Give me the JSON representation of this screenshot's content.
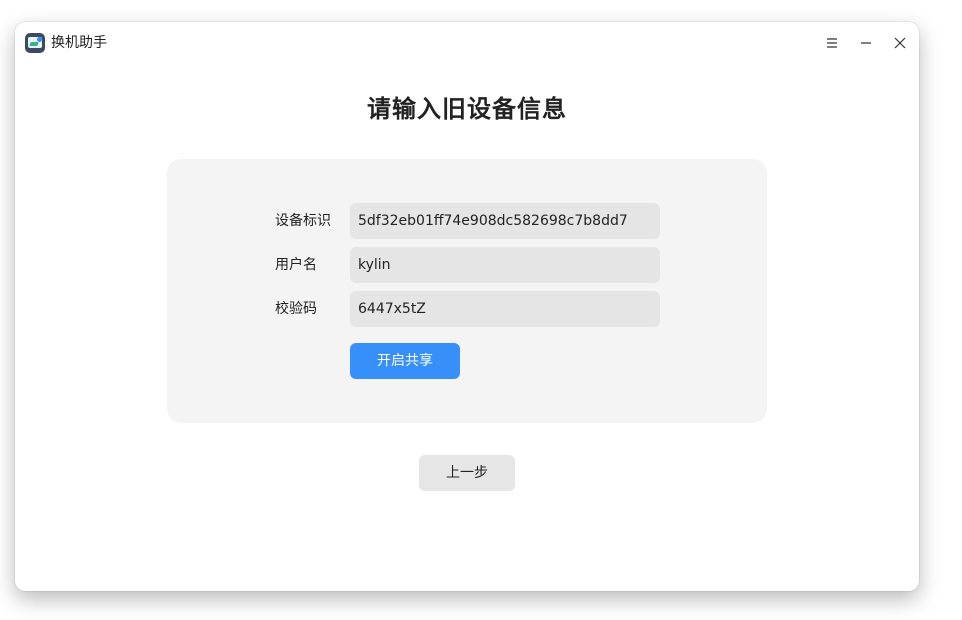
{
  "window": {
    "title": "换机助手",
    "controls": {
      "menu_icon": "menu-icon",
      "minimize_icon": "minimize-icon",
      "close_icon": "close-icon"
    }
  },
  "main": {
    "heading": "请输入旧设备信息",
    "form": {
      "device_id": {
        "label": "设备标识",
        "value": "5df32eb01ff74e908dc582698c7b8dd7"
      },
      "username": {
        "label": "用户名",
        "value": "kylin"
      },
      "verification_code": {
        "label": "校验码",
        "value": "6447x5tZ"
      }
    },
    "buttons": {
      "start_share": "开启共享",
      "previous_step": "上一步"
    }
  },
  "colors": {
    "accent": "#3790fa",
    "panel_background": "#f4f4f4",
    "field_background": "#e5e5e5"
  }
}
